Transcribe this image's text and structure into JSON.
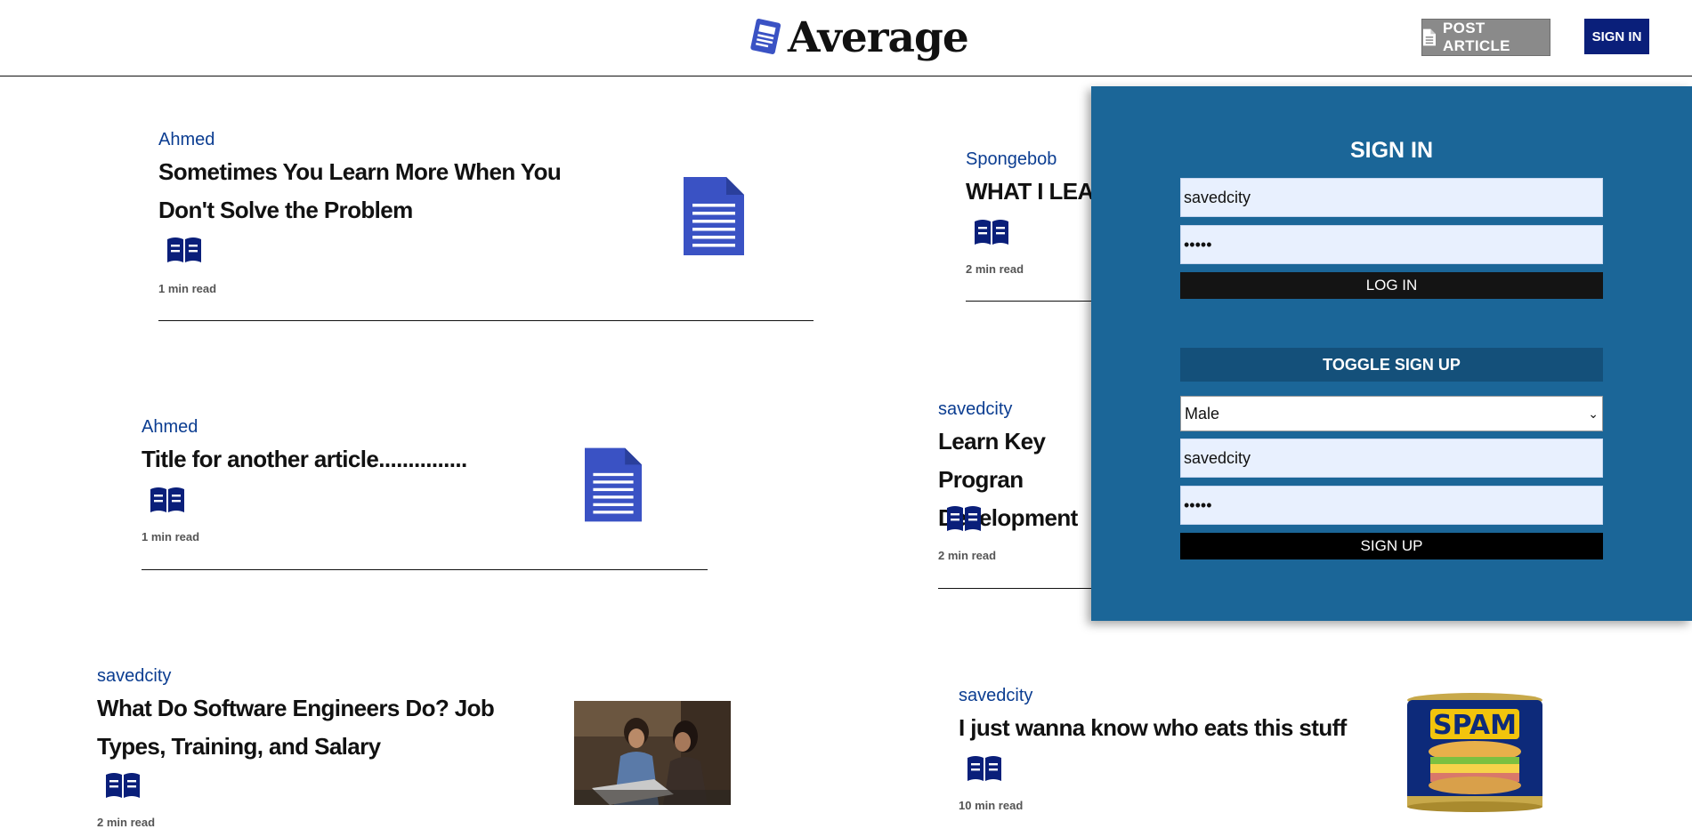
{
  "header": {
    "brand": "Average",
    "post_article_label": "POST ARTICLE",
    "sign_in_label": "SIGN IN"
  },
  "articles": [
    {
      "author": "Ahmed",
      "title": "Sometimes You Learn More When You Don't Solve the Problem",
      "read_time": "1 min read",
      "thumbnail": "document-icon"
    },
    {
      "author": "Spongebob",
      "title": "WHAT I LEARNE",
      "read_time": "2 min read",
      "thumbnail": ""
    },
    {
      "author": "Ahmed",
      "title": "Title for another article...............",
      "read_time": "1 min read",
      "thumbnail": "document-icon"
    },
    {
      "author": "savedcity",
      "title": "Learn Key Progran Development",
      "read_time": "2 min read",
      "thumbnail": ""
    },
    {
      "author": "savedcity",
      "title": "What Do Software Engineers Do? Job Types, Training, and Salary",
      "read_time": "2 min read",
      "thumbnail": "photo-two-women-laptop"
    },
    {
      "author": "savedcity",
      "title": "I just wanna know who eats this stuff",
      "read_time": "10 min read",
      "thumbnail": "spam-can-image"
    }
  ],
  "signin_panel": {
    "title": "SIGN IN",
    "login_username": "savedcity",
    "login_password_mask": "•••••",
    "login_button": "LOG IN",
    "toggle_signup_button": "TOGGLE SIGN UP",
    "gender_selected": "Male",
    "signup_username": "savedcity",
    "signup_password_mask": "•••••",
    "signup_button": "SIGN UP"
  },
  "colors": {
    "brand_blue": "#0a1f7a",
    "author_blue": "#0b3d91",
    "panel_blue": "#1b6698",
    "icon_blue": "#3a52c4"
  }
}
